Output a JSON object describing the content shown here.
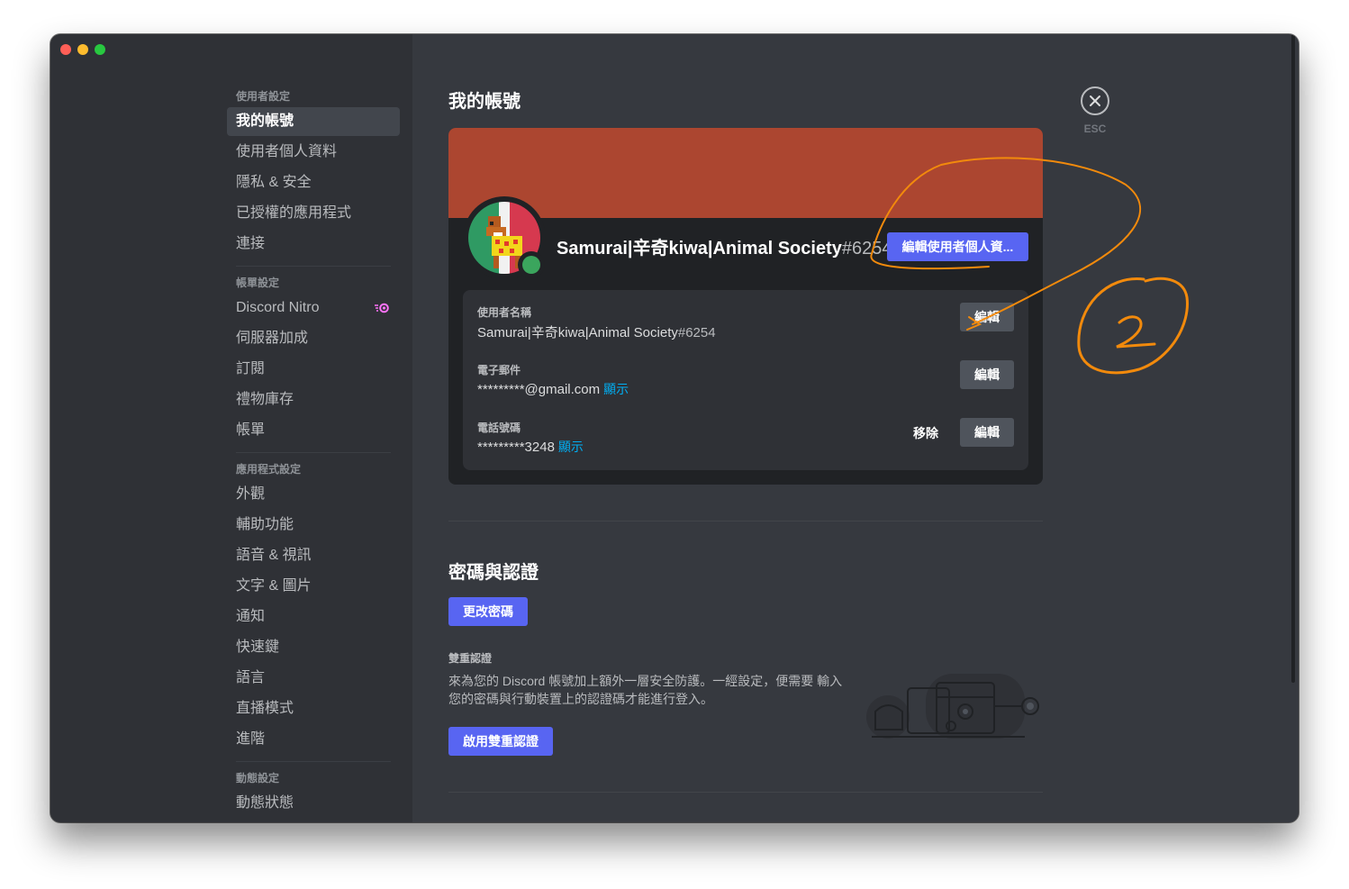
{
  "sidebar": {
    "sections": [
      {
        "header": "使用者設定",
        "items": [
          "我的帳號",
          "使用者個人資料",
          "隱私 & 安全",
          "已授權的應用程式",
          "連接"
        ]
      },
      {
        "header": "帳單設定",
        "items": [
          "Discord Nitro",
          "伺服器加成",
          "訂閱",
          "禮物庫存",
          "帳單"
        ]
      },
      {
        "header": "應用程式設定",
        "items": [
          "外觀",
          "輔助功能",
          "語音 & 視訊",
          "文字 & 圖片",
          "通知",
          "快速鍵",
          "語言",
          "直播模式",
          "進階"
        ]
      },
      {
        "header": "動態設定",
        "items": [
          "動態狀態"
        ]
      }
    ]
  },
  "main": {
    "title": "我的帳號",
    "profile": {
      "display_name": "Samurai|辛奇kiwa|Animal Society",
      "tag": "#6254",
      "edit_profile_label": "編輯使用者個人資...",
      "banner_color": "#ac4630",
      "status_color": "#3ba55d"
    },
    "fields": {
      "username": {
        "label": "使用者名稱",
        "value": "Samurai|辛奇kiwa|Animal Society",
        "tag": "#6254",
        "edit_label": "編輯"
      },
      "email": {
        "label": "電子郵件",
        "value": "*********@gmail.com",
        "reveal": "顯示",
        "edit_label": "編輯"
      },
      "phone": {
        "label": "電話號碼",
        "value": "*********3248",
        "reveal": "顯示",
        "remove_label": "移除",
        "edit_label": "編輯"
      }
    },
    "password_section": {
      "title": "密碼與認證",
      "change_password_label": "更改密碼",
      "twofa_label": "雙重認證",
      "twofa_desc": "來為您的 Discord 帳號加上額外一層安全防護。一經設定，便需要 輸入您的密碼與行動裝置上的認證碼才能進行登入。",
      "enable_twofa_label": "啟用雙重認證"
    },
    "close": {
      "label": "ESC"
    }
  },
  "colors": {
    "accent": "#5865f2",
    "link": "#00aff4",
    "annotation": "#f28a0c"
  }
}
